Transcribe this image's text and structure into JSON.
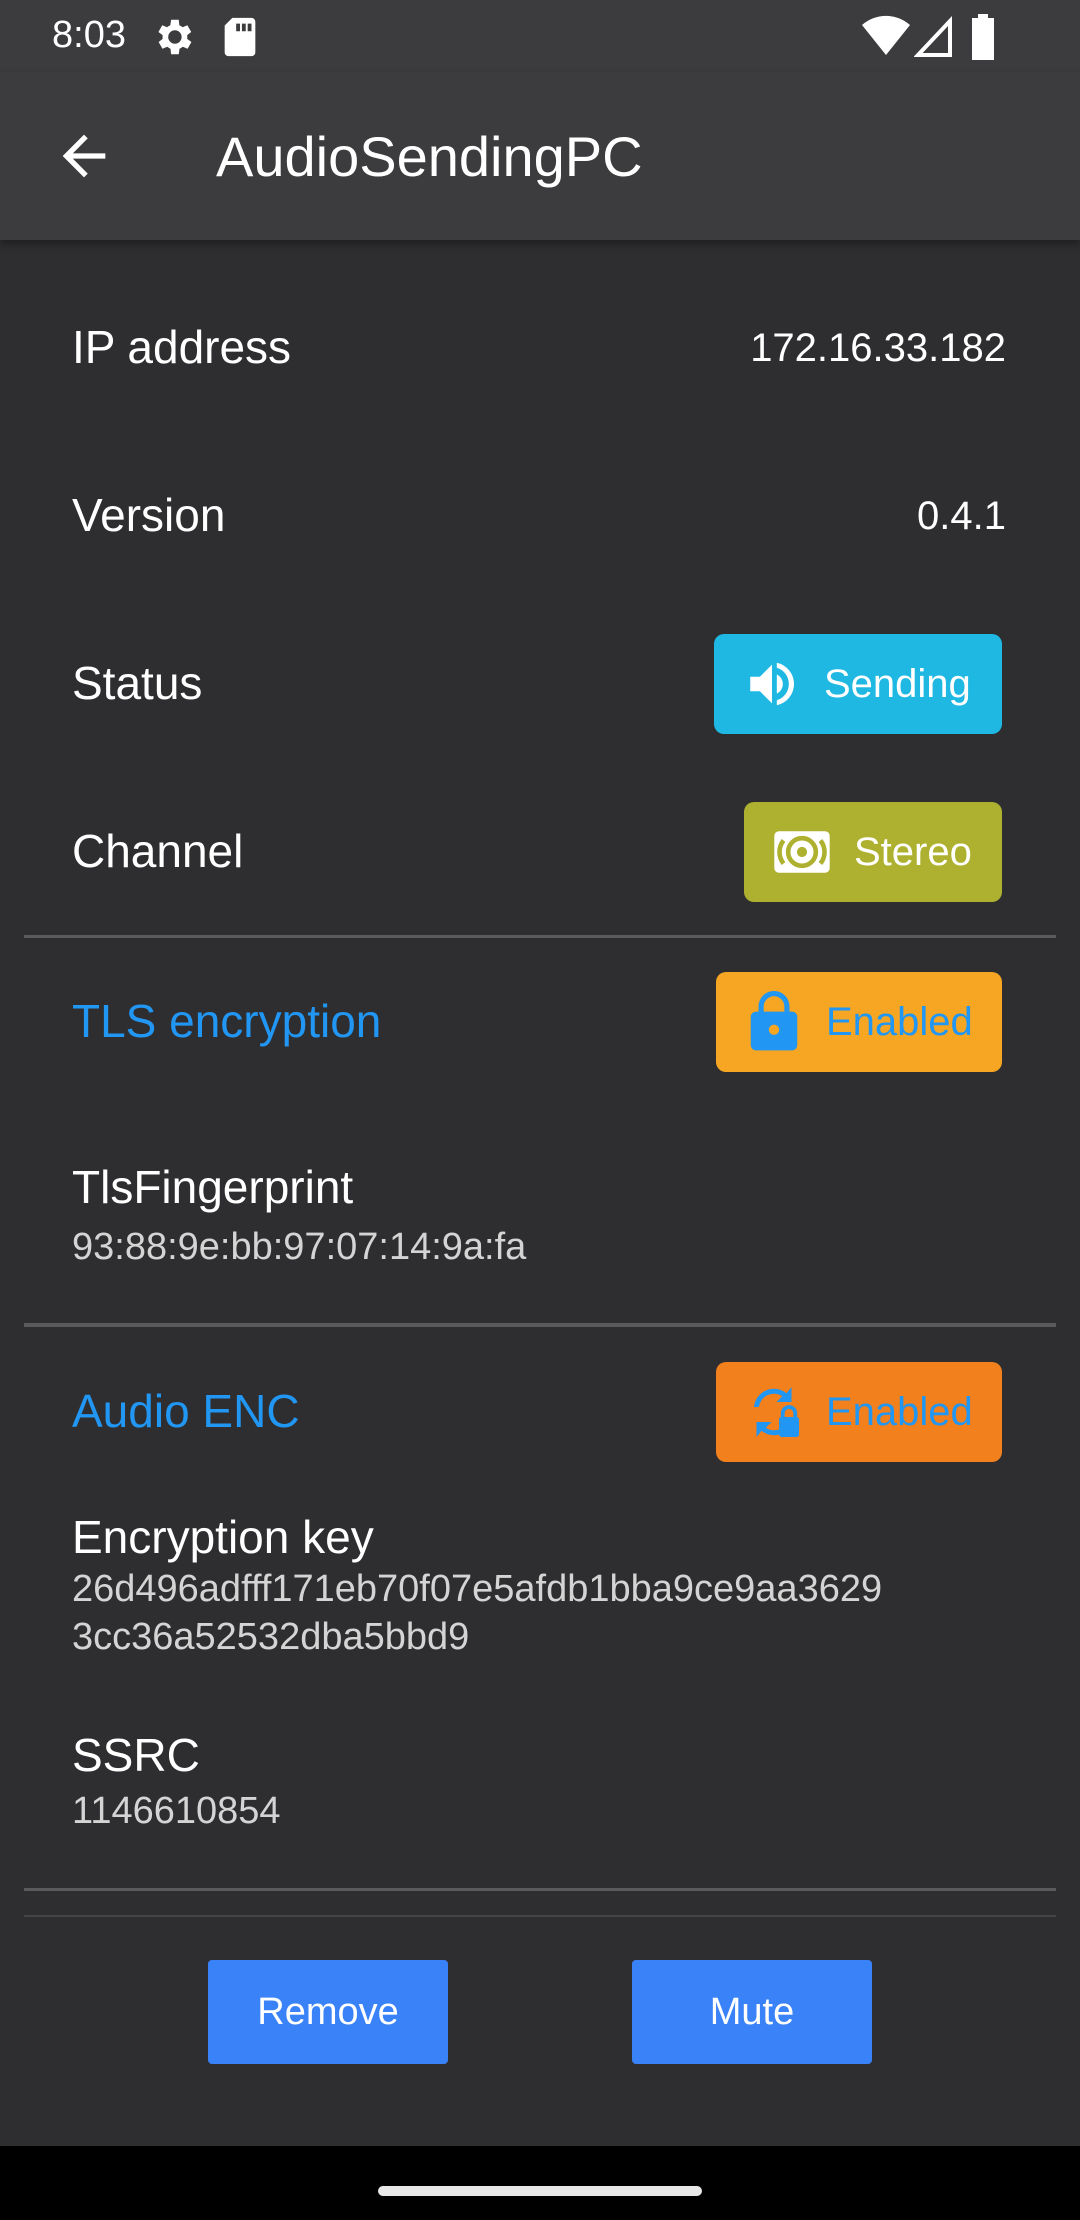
{
  "status_bar": {
    "time": "8:03",
    "icons": [
      "settings-icon",
      "sd-card-icon",
      "wifi-alert-icon",
      "signal-icon",
      "battery-icon"
    ]
  },
  "app_bar": {
    "title": "AudioSendingPC",
    "back_icon": "arrow-back-icon"
  },
  "info": {
    "ip_label": "IP address",
    "ip_value": "172.16.33.182",
    "version_label": "Version",
    "version_value": "0.4.1",
    "status_label": "Status",
    "status_value": "Sending",
    "status_icon": "speaker-icon",
    "status_color": "#1eb8e2",
    "channel_label": "Channel",
    "channel_value": "Stereo",
    "channel_icon": "surround-sound-icon",
    "channel_color": "#aeb12f"
  },
  "tls": {
    "label": "TLS encryption",
    "chip_value": "Enabled",
    "chip_icon": "lock-icon",
    "chip_color": "#f6a623",
    "fingerprint_label": "TlsFingerprint",
    "fingerprint_value": "93:88:9e:bb:97:07:14:9a:fa"
  },
  "audio_enc": {
    "label": "Audio ENC",
    "chip_value": "Enabled",
    "chip_icon": "lock-reset-icon",
    "chip_color": "#f1801d",
    "key_label": "Encryption key",
    "key_line1": "26d496adfff171eb70f07e5afdb1bba9ce9aa3629",
    "key_line2": "3cc36a52532dba5bbd9",
    "ssrc_label": "SSRC",
    "ssrc_value": "1146610854"
  },
  "actions": {
    "remove_label": "Remove",
    "mute_label": "Mute",
    "button_color": "#3a82f7"
  },
  "accent_color": "#2196f3"
}
